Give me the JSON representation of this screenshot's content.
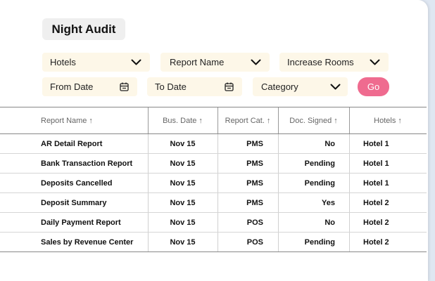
{
  "page_title": "Night Audit",
  "filters": {
    "hotels": "Hotels",
    "report_name": "Report Name",
    "increase_rooms": "Increase Rooms",
    "from_date": "From Date",
    "to_date": "To Date",
    "category": "Category",
    "go": "Go"
  },
  "colors": {
    "filter_bg": "#fdf7e8",
    "go_button": "#ef6b8f",
    "page_bg": "#dfe7f2"
  },
  "icons": {
    "dropdown": "chevron-down-icon",
    "date": "calendar-icon",
    "sort": "sort-arrow-up"
  },
  "table": {
    "headers": [
      "Report Name",
      "Bus. Date",
      "Report Cat.",
      "Doc. Signed",
      "Hotels"
    ],
    "sort_glyph": "↑",
    "rows": [
      [
        "AR Detail Report",
        "Nov 15",
        "PMS",
        "No",
        "Hotel 1"
      ],
      [
        "Bank Transaction Report",
        "Nov 15",
        "PMS",
        "Pending",
        "Hotel 1"
      ],
      [
        "Deposits Cancelled",
        "Nov 15",
        "PMS",
        "Pending",
        "Hotel 1"
      ],
      [
        "Deposit Summary",
        "Nov 15",
        "PMS",
        "Yes",
        "Hotel 2"
      ],
      [
        "Daily Payment Report",
        "Nov 15",
        "POS",
        "No",
        "Hotel 2"
      ],
      [
        "Sales by Revenue Center",
        "Nov 15",
        "POS",
        "Pending",
        "Hotel 2"
      ]
    ]
  }
}
